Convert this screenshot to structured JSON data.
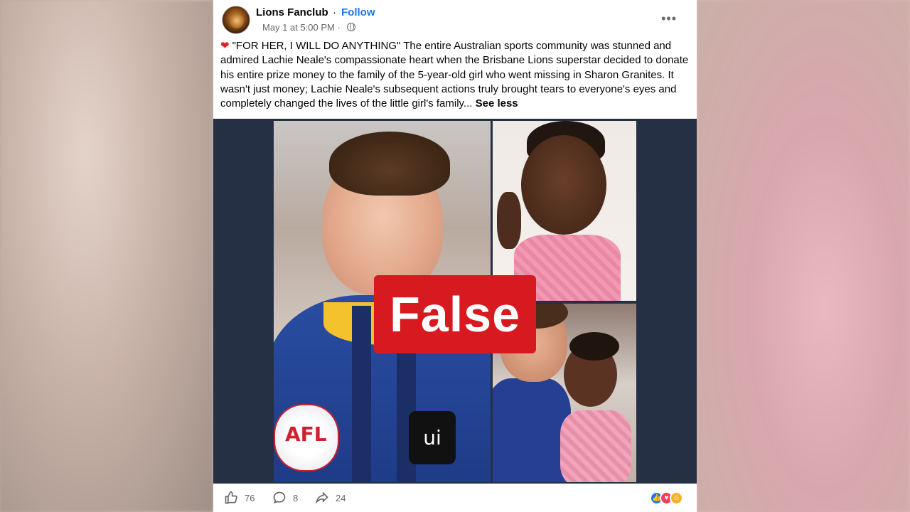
{
  "post": {
    "page_name": "Lions Fanclub",
    "separator": "·",
    "follow_label": "Follow",
    "timestamp": "May 1 at 5:00 PM ·",
    "caption_main": "\"FOR HER, I WILL DO ANYTHING\" The entire Australian sports community was stunned and admired Lachie Neale's compassionate heart when the Brisbane Lions superstar decided to donate his entire prize money to the family of the 5-year-old girl who went missing in Sharon Granites. It wasn't just money; Lachie Neale's subsequent actions truly brought tears to everyone's eyes and completely changed the lives of the little girl's family...",
    "see_less": "See less"
  },
  "media": {
    "overlay_label": "False",
    "badge_text": "AFL",
    "sponsor_text": "ui"
  },
  "actions": {
    "likes": "76",
    "comments": "8",
    "shares": "24"
  },
  "icons": {
    "more": "more-icon",
    "globe": "globe-icon",
    "heart": "heart-icon",
    "like": "thumbs-up-icon",
    "comment": "comment-icon",
    "share": "share-icon"
  },
  "colors": {
    "accent": "#1877f2",
    "false_badge": "#d71920",
    "media_bg": "#253045"
  }
}
